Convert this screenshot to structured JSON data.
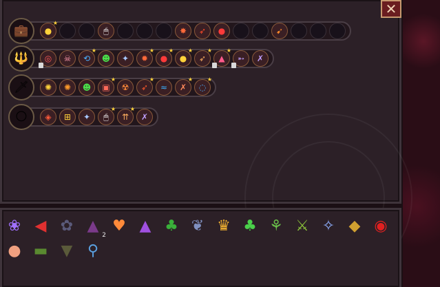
{
  "close_label": "✕",
  "weapon_rows": [
    {
      "name": "row-boomerang",
      "weapon_icon": "💼",
      "slots": [
        {
          "icon": "coin-icon",
          "glyph": "●",
          "color": "#ffd23a",
          "star": true,
          "lock": false
        },
        {
          "empty": true
        },
        {
          "empty": true
        },
        {
          "icon": "mouse-icon",
          "glyph": "🖱",
          "color": "#ffffff",
          "star": false,
          "lock": false
        },
        {
          "empty": true
        },
        {
          "empty": true
        },
        {
          "empty": true
        },
        {
          "icon": "burst-icon",
          "glyph": "✸",
          "color": "#ff6a3a",
          "star": false,
          "lock": false
        },
        {
          "icon": "fire-arrow-icon",
          "glyph": "➶",
          "color": "#ff4a2a",
          "star": false,
          "lock": false
        },
        {
          "icon": "bomb-icon",
          "glyph": "●",
          "color": "#ff3a3a",
          "star": false,
          "lock": false
        },
        {
          "empty": true
        },
        {
          "empty": true
        },
        {
          "icon": "carrot-icon",
          "glyph": "➹",
          "color": "#ff8a2a",
          "star": false,
          "lock": false
        },
        {
          "empty": true
        },
        {
          "empty": true
        },
        {
          "empty": true
        }
      ]
    },
    {
      "name": "row-staff",
      "weapon_icon": "🔱",
      "slots": [
        {
          "icon": "target-icon",
          "glyph": "◎",
          "color": "#ff5a5a",
          "star": false,
          "lock": true
        },
        {
          "icon": "skull-icon",
          "glyph": "☠",
          "color": "#ff9ab0",
          "star": false,
          "lock": false
        },
        {
          "icon": "spiral-icon",
          "glyph": "⟲",
          "color": "#4ab0ff",
          "star": true,
          "lock": false
        },
        {
          "icon": "skull-green-icon",
          "glyph": "☻",
          "color": "#4adf4a",
          "star": false,
          "lock": false
        },
        {
          "icon": "shuriken-icon",
          "glyph": "✦",
          "color": "#a8c8ff",
          "star": false,
          "lock": false
        },
        {
          "icon": "fire-burst-icon",
          "glyph": "✹",
          "color": "#ff6a3a",
          "star": true,
          "lock": false
        },
        {
          "icon": "bomb-icon",
          "glyph": "●",
          "color": "#ff3a3a",
          "star": true,
          "lock": false
        },
        {
          "icon": "coin-icon",
          "glyph": "●",
          "color": "#ffd23a",
          "star": true,
          "lock": false
        },
        {
          "icon": "feather-icon",
          "glyph": "➶",
          "color": "#ffb060",
          "star": true,
          "lock": false
        },
        {
          "icon": "tent-icon",
          "glyph": "▲",
          "color": "#ff5a8a",
          "star": true,
          "lock": true
        },
        {
          "icon": "bow-icon",
          "glyph": "➵",
          "color": "#c0a0ff",
          "star": false,
          "lock": true
        },
        {
          "icon": "crossbow-icon",
          "glyph": "✗",
          "color": "#c0a0ff",
          "star": false,
          "lock": false
        }
      ]
    },
    {
      "name": "row-blade",
      "weapon_icon": "🗡",
      "slots": [
        {
          "icon": "sun-icon",
          "glyph": "✺",
          "color": "#ffd23a",
          "star": false,
          "lock": false
        },
        {
          "icon": "sun-orange-icon",
          "glyph": "✺",
          "color": "#ff9a2a",
          "star": false,
          "lock": false
        },
        {
          "icon": "skull-green-icon",
          "glyph": "☻",
          "color": "#4adf4a",
          "star": false,
          "lock": false
        },
        {
          "icon": "potion-icon",
          "glyph": "▣",
          "color": "#ff6a5a",
          "star": true,
          "lock": false
        },
        {
          "icon": "radiation-icon",
          "glyph": "☢",
          "color": "#ff8a3a",
          "star": false,
          "lock": false
        },
        {
          "icon": "fire-arrow-icon",
          "glyph": "➶",
          "color": "#ff5a2a",
          "star": true,
          "lock": false
        },
        {
          "icon": "wave-icon",
          "glyph": "≈",
          "color": "#3ab0ff",
          "star": false,
          "lock": false
        },
        {
          "icon": "crossed-icon",
          "glyph": "✗",
          "color": "#ff8a5a",
          "star": true,
          "lock": false
        },
        {
          "icon": "ring-icon",
          "glyph": "◌",
          "color": "#4ab0ff",
          "star": true,
          "lock": false
        }
      ]
    },
    {
      "name": "row-orb",
      "weapon_icon": "🌕",
      "slots": [
        {
          "icon": "diamond-icon",
          "glyph": "◈",
          "color": "#ff5a3a",
          "star": false,
          "lock": false
        },
        {
          "icon": "waffle-icon",
          "glyph": "⊞",
          "color": "#ffd23a",
          "star": false,
          "lock": false
        },
        {
          "icon": "shuriken-icon",
          "glyph": "✦",
          "color": "#a8c8ff",
          "star": false,
          "lock": false
        },
        {
          "icon": "mouse-icon",
          "glyph": "🖱",
          "color": "#ffffff",
          "star": true,
          "lock": false
        },
        {
          "icon": "arrows-up-icon",
          "glyph": "⇈",
          "color": "#ffb060",
          "star": true,
          "lock": false
        },
        {
          "icon": "crossbow-icon",
          "glyph": "✗",
          "color": "#c0a0ff",
          "star": false,
          "lock": false
        }
      ]
    }
  ],
  "inventory": [
    {
      "icon": "hair-icon",
      "glyph": "❀",
      "color": "#a070ff",
      "count": ""
    },
    {
      "icon": "bird-icon",
      "glyph": "◀",
      "color": "#e03030",
      "count": ""
    },
    {
      "icon": "dark-blob-icon",
      "glyph": "✿",
      "color": "#5a5a7a",
      "count": ""
    },
    {
      "icon": "hat-icon",
      "glyph": "▲",
      "color": "#7a3a8a",
      "count": "2"
    },
    {
      "icon": "heart-icon",
      "glyph": "♥",
      "color": "#ff8a3a",
      "count": ""
    },
    {
      "icon": "witch-hat-icon",
      "glyph": "▲",
      "color": "#a050e0",
      "count": ""
    },
    {
      "icon": "plant-icon",
      "glyph": "♣",
      "color": "#3ab03a",
      "count": ""
    },
    {
      "icon": "feather-icon",
      "glyph": "❦",
      "color": "#8090c0",
      "count": ""
    },
    {
      "icon": "trophy-icon",
      "glyph": "♛",
      "color": "#f0b030",
      "count": ""
    },
    {
      "icon": "clover-icon",
      "glyph": "♣",
      "color": "#4ad04a",
      "count": ""
    },
    {
      "icon": "sprout-icon",
      "glyph": "⚘",
      "color": "#6ac04a",
      "count": ""
    },
    {
      "icon": "sword-icon",
      "glyph": "⚔",
      "color": "#8ac03a",
      "count": ""
    },
    {
      "icon": "crown-icon",
      "glyph": "✧",
      "color": "#90b0ff",
      "count": ""
    },
    {
      "icon": "cube-icon",
      "glyph": "◆",
      "color": "#d0a030",
      "count": ""
    },
    {
      "icon": "eye-icon",
      "glyph": "◉",
      "color": "#e02020",
      "count": ""
    },
    {
      "icon": "pig-icon",
      "glyph": "●",
      "color": "#f0a080",
      "count": ""
    },
    {
      "icon": "shorts-icon",
      "glyph": "▬",
      "color": "#5a8a30",
      "count": ""
    },
    {
      "icon": "cape-icon",
      "glyph": "▼",
      "color": "#5a5a3a",
      "count": ""
    },
    {
      "icon": "magnifier-icon",
      "glyph": "⚲",
      "color": "#5aa0e0",
      "count": ""
    }
  ]
}
